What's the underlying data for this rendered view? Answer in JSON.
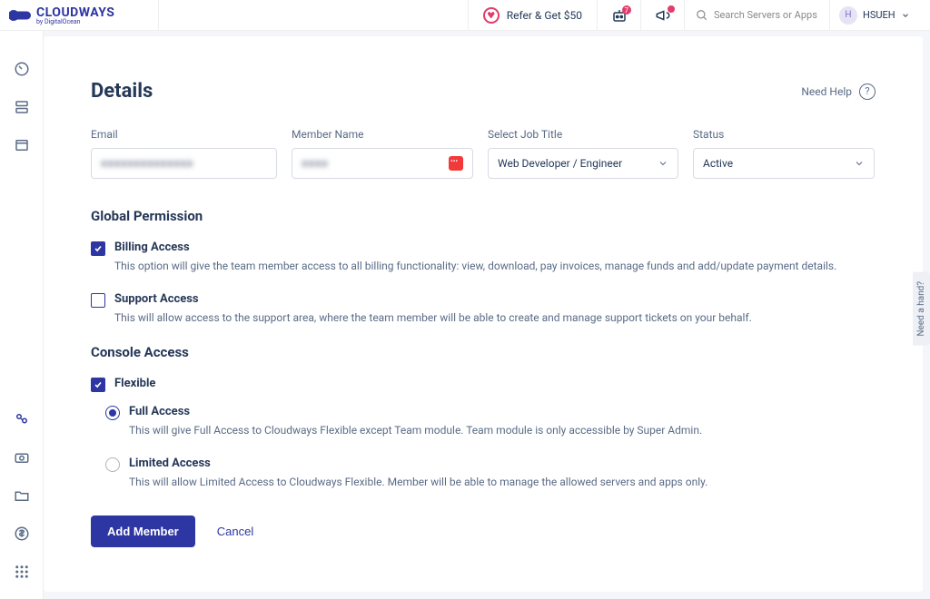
{
  "header": {
    "brand_primary": "CLOUDWAYS",
    "brand_secondary": "by DigitalOcean",
    "refer_label": "Refer & Get $50",
    "notif_count": "7",
    "search_placeholder": "Search Servers or Apps",
    "user_initial": "H",
    "user_name": "HSUEH"
  },
  "help_tab": "Need a hand?",
  "page": {
    "title": "Details",
    "need_help": "Need Help"
  },
  "fields": {
    "email": {
      "label": "Email",
      "value": "■■■■■■■■■■■■■■"
    },
    "member_name": {
      "label": "Member Name",
      "value": "■■■■"
    },
    "job_title": {
      "label": "Select Job Title",
      "value": "Web Developer / Engineer"
    },
    "status": {
      "label": "Status",
      "value": "Active"
    }
  },
  "sections": {
    "global": "Global Permission",
    "console": "Console Access"
  },
  "permissions": {
    "billing": {
      "title": "Billing Access",
      "desc": "This option will give the team member access to all billing functionality: view, download, pay invoices, manage funds and add/update payment details."
    },
    "support": {
      "title": "Support Access",
      "desc": "This will allow access to the support area, where the team member will be able to create and manage support tickets on your behalf."
    },
    "flexible": {
      "title": "Flexible"
    },
    "full": {
      "title": "Full Access",
      "desc": "This will give Full Access to Cloudways Flexible except Team module. Team module is only accessible by Super Admin."
    },
    "limited": {
      "title": "Limited Access",
      "desc": "This will allow Limited Access to Cloudways Flexible. Member will be able to manage the allowed servers and apps only."
    }
  },
  "actions": {
    "add": "Add Member",
    "cancel": "Cancel"
  }
}
